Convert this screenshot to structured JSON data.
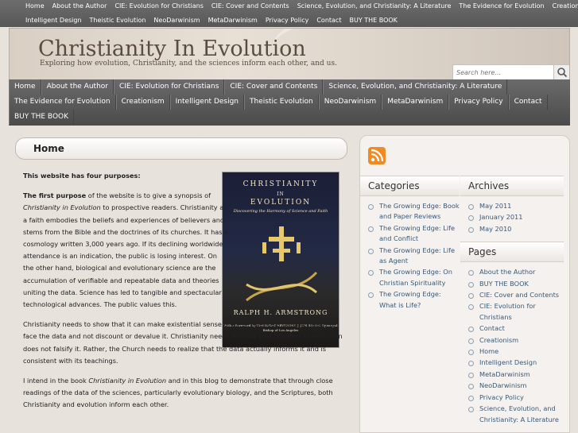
{
  "top_nav": {
    "row1": [
      "Home",
      "About the Author",
      "CIE: Evolution for Christians",
      "CIE: Cover and Contents",
      "Science, Evolution, and Christianity: A Literature",
      "The Evidence for Evolution",
      "Creationism"
    ],
    "row2": [
      "Intelligent Design",
      "Theistic Evolution",
      "NeoDarwinism",
      "MetaDarwinism",
      "Privacy Policy",
      "Contact",
      "BUY THE BOOK"
    ]
  },
  "header": {
    "title": "Christianity In Evolution",
    "description": "Exploring how evolution, Christianity, and the sciences inform each other, and us."
  },
  "search": {
    "placeholder": "Search here..."
  },
  "main_nav": {
    "row1": [
      "Home",
      "About the Author",
      "CIE: Evolution for Christians",
      "CIE: Cover and Contents",
      "Science, Evolution, and Christianity: A Literature"
    ],
    "row2": [
      "The Evidence for Evolution",
      "Creationism",
      "Intelligent Design",
      "Theistic Evolution",
      "NeoDarwinism",
      "MetaDarwinism",
      "Privacy Policy",
      "Contact"
    ],
    "row3": [
      "BUY THE BOOK"
    ]
  },
  "page": {
    "heading": "Home",
    "intro": "This website has four purposes:",
    "p1_bold": "The first purpose",
    "p1_a": " of the website is to give a synopsis of ",
    "p1_italic": "Christianity in Evolution",
    "p1_b": " to prospective readers. Christianity as a faith embodies the beliefs and experiences of believers and stems from the Bible and the doctrines of its churches.  It has a cosmology written 3,000 years ago.  If its declining worldwide attendance is an indication, the public is losing interest.  On the other hand, biological and evolutionary science are the accumulation of verifiable and repeatable data and theories uniting the data.  Science has led to tangible and spectacular technological advances.  The public values this.",
    "p2": "Christianity needs to show that it can make existential sense of all of science’s data.  It needs to face the data and not     discount or devalue it.  Christianity needs to show that the data of evolution does not falsify it.  Rather, the Church needs to realize that the data actually informs it and is consistent with its teachings.",
    "p3_a": "I intend in the book ",
    "p3_italic": "Christianity in Evolution",
    "p3_b": " and in this blog to demonstrate that through close readings of the data of the sciences, particularly evolutionary biology, and the Scriptures, both Christianity and evolution inform each other."
  },
  "book_cover": {
    "line1": "CHRISTIANITY",
    "line2": "IN",
    "line3": "EVOLUTION",
    "subtitle": "Discovering the Harmony of Science and Faith",
    "author": "RALPH H. ARMSTRONG",
    "foreword": "With a Foreword by THE RIGHT REVEREND J. JON BRUNO Episcopal Bishop of Los Angeles"
  },
  "sidebar": {
    "categories_title": "Categories",
    "categories": [
      "The Growing Edge: Book and Paper Reviews",
      "The Growing Edge: Life and Conflict",
      "The Growing Edge: Life as Agent",
      "The Growing Edge: On Christian Spirituality",
      "The Growing Edge: What is Life?"
    ],
    "archives_title": "Archives",
    "archives": [
      "May 2011",
      "January 2011",
      "May 2010"
    ],
    "pages_title": "Pages",
    "pages": [
      "About the Author",
      "BUY THE BOOK",
      "CIE: Cover and Contents",
      "CIE: Evolution for Christians",
      "Contact",
      "Creationism",
      "Home",
      "Intelligent Design",
      "MetaDarwinism",
      "NeoDarwinism",
      "Privacy Policy",
      "Science, Evolution, and Christianity: A Literature"
    ]
  }
}
